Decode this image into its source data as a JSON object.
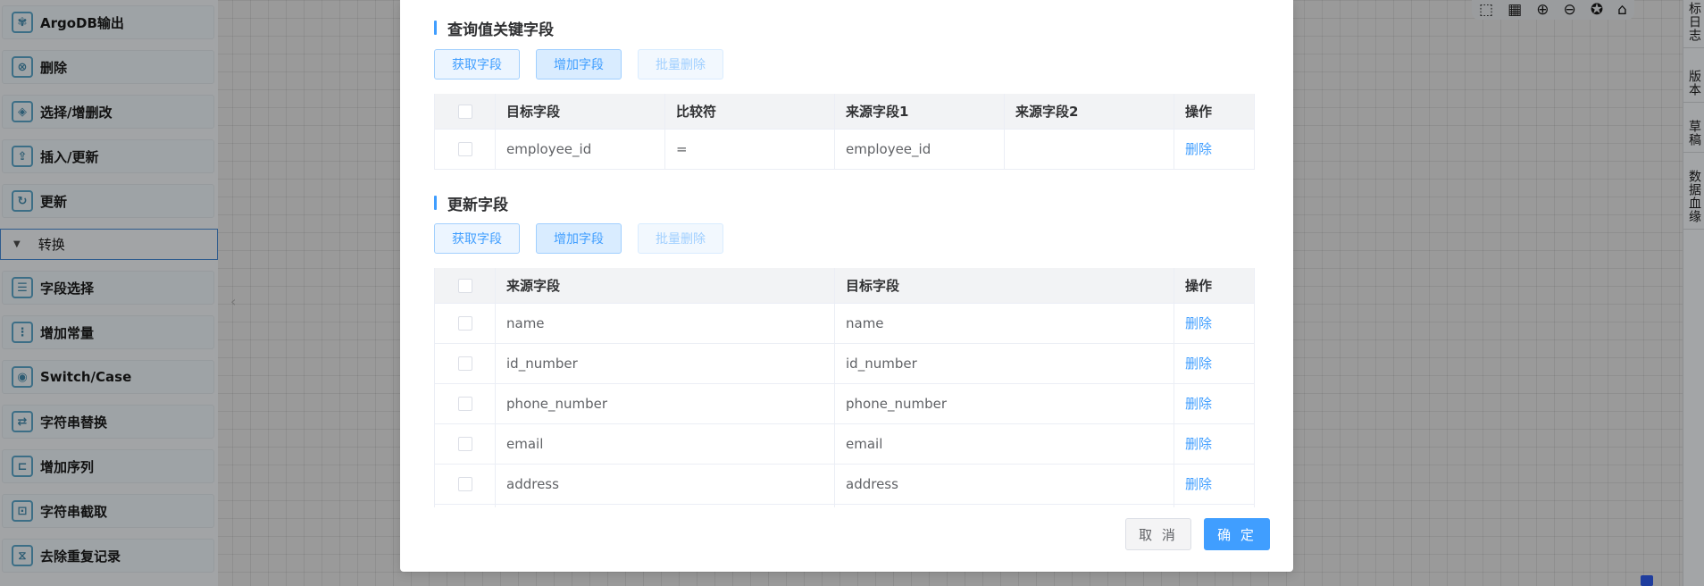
{
  "sidebar": {
    "items": [
      {
        "label": "ArgoDB输出",
        "icon": "argodb-icon",
        "glyph": "✾"
      },
      {
        "label": "删除",
        "icon": "delete-circle-icon",
        "glyph": "⊗"
      },
      {
        "label": "选择/增删改",
        "icon": "cube-icon",
        "glyph": "◈"
      },
      {
        "label": "插入/更新",
        "icon": "insert-update-icon",
        "glyph": "⇪"
      },
      {
        "label": "更新",
        "icon": "refresh-icon",
        "glyph": "↻"
      }
    ],
    "group": {
      "label": "转换",
      "caret": "▼"
    },
    "group_items": [
      {
        "label": "字段选择",
        "icon": "field-select-icon",
        "glyph": "☰"
      },
      {
        "label": "增加常量",
        "icon": "add-constant-icon",
        "glyph": "⋮"
      },
      {
        "label": "Switch/Case",
        "icon": "switch-case-icon",
        "glyph": "◉"
      },
      {
        "label": "字符串替换",
        "icon": "string-replace-icon",
        "glyph": "⇄"
      },
      {
        "label": "增加序列",
        "icon": "add-sequence-icon",
        "glyph": "⊏"
      },
      {
        "label": "字符串截取",
        "icon": "string-cut-icon",
        "glyph": "⊡"
      },
      {
        "label": "去除重复记录",
        "icon": "dedupe-icon",
        "glyph": "⧖"
      }
    ],
    "collapse_glyph": "‹"
  },
  "toolbar": {
    "icons": [
      {
        "name": "select-area-icon",
        "glyph": "⬚"
      },
      {
        "name": "grid-icon",
        "glyph": "▦"
      },
      {
        "name": "zoom-in-icon",
        "glyph": "⊕"
      },
      {
        "name": "zoom-out-icon",
        "glyph": "⊖"
      },
      {
        "name": "badge-icon",
        "glyph": "✪"
      },
      {
        "name": "bookmark-icon",
        "glyph": "⌂"
      }
    ]
  },
  "right_rail": {
    "tabs": [
      "标日志",
      "版本",
      "草稿",
      "数据血缘"
    ]
  },
  "modal": {
    "lookup_section": {
      "title": "查询值关键字段",
      "buttons": {
        "fetch": "获取字段",
        "add": "增加字段",
        "batch_delete": "批量删除"
      },
      "columns": [
        "目标字段",
        "比较符",
        "来源字段1",
        "来源字段2",
        "操作"
      ],
      "rows": [
        {
          "target": "employee_id",
          "comparator": "=",
          "source1": "employee_id",
          "source2": "",
          "action": "删除"
        }
      ]
    },
    "update_section": {
      "title": "更新字段",
      "buttons": {
        "fetch": "获取字段",
        "add": "增加字段",
        "batch_delete": "批量删除"
      },
      "columns": [
        "来源字段",
        "目标字段",
        "操作"
      ],
      "rows": [
        {
          "source": "name",
          "target": "name",
          "action": "删除"
        },
        {
          "source": "id_number",
          "target": "id_number",
          "action": "删除"
        },
        {
          "source": "phone_number",
          "target": "phone_number",
          "action": "删除"
        },
        {
          "source": "email",
          "target": "email",
          "action": "删除"
        },
        {
          "source": "address",
          "target": "address",
          "action": "删除"
        }
      ]
    },
    "footer": {
      "cancel": "取 消",
      "ok": "确 定"
    }
  }
}
